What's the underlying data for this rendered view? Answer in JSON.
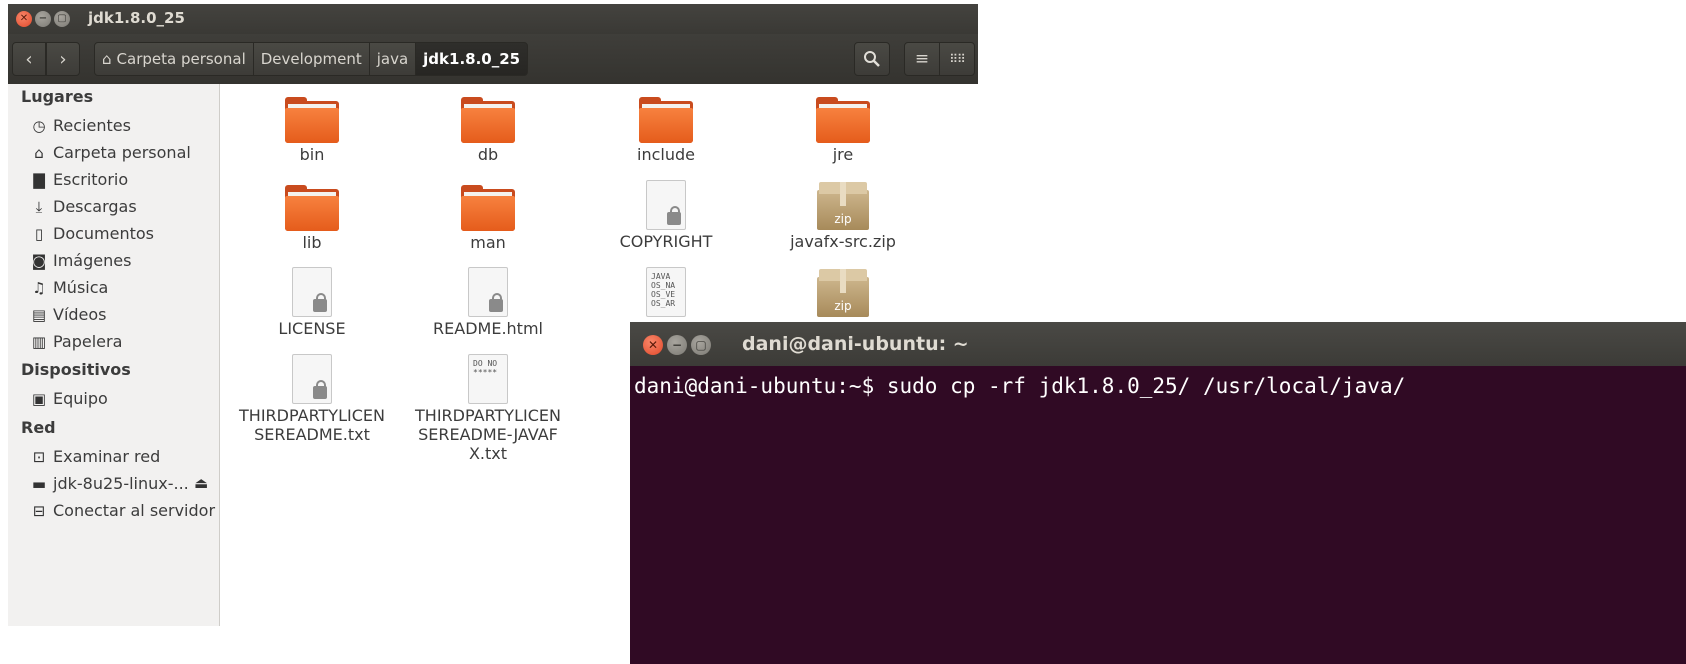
{
  "file_manager": {
    "title": "jdk1.8.0_25",
    "breadcrumbs": [
      "Carpeta personal",
      "Development",
      "java",
      "jdk1.8.0_25"
    ],
    "sidebar": {
      "sections": {
        "places": "Lugares",
        "devices": "Dispositivos",
        "network": "Red"
      },
      "places": [
        "Recientes",
        "Carpeta personal",
        "Escritorio",
        "Descargas",
        "Documentos",
        "Imágenes",
        "Música",
        "Vídeos",
        "Papelera"
      ],
      "devices": [
        "Equipo"
      ],
      "network": [
        "Examinar red",
        "jdk-8u25-linux-...",
        "Conectar al servidor"
      ]
    },
    "files": [
      {
        "name": "bin",
        "type": "folder"
      },
      {
        "name": "db",
        "type": "folder"
      },
      {
        "name": "include",
        "type": "folder"
      },
      {
        "name": "jre",
        "type": "folder"
      },
      {
        "name": "lib",
        "type": "folder"
      },
      {
        "name": "man",
        "type": "folder"
      },
      {
        "name": "COPYRIGHT",
        "type": "locked-document"
      },
      {
        "name": "javafx-src.zip",
        "type": "zip"
      },
      {
        "name": "LICENSE",
        "type": "locked-document"
      },
      {
        "name": "README.html",
        "type": "locked-document"
      },
      {
        "name": "THIRDPARTYLICENSEREADME.txt",
        "type": "locked-document"
      },
      {
        "name": "THIRDPARTYLICENSEREADME-JAVAFX.txt",
        "type": "text-document",
        "preview": "DO NO\n*****"
      }
    ],
    "partially_visible": [
      {
        "type": "text-document",
        "preview": "JAVA\nOS_NA\nOS_VE\nOS_AR"
      },
      {
        "type": "zip",
        "icon_label": "zip"
      }
    ],
    "zip_icon_label": "zip"
  },
  "terminal": {
    "title": "dani@dani-ubuntu: ~",
    "prompt": "dani@dani-ubuntu:~$",
    "command": "sudo cp -rf jdk1.8.0_25/ /usr/local/java/"
  }
}
